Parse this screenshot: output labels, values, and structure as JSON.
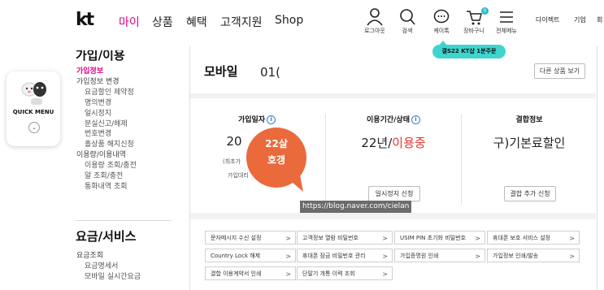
{
  "header": {
    "logo": "kt",
    "nav": [
      "마이",
      "상품",
      "혜택",
      "고객지원",
      "Shop"
    ],
    "icons": [
      {
        "name": "login-icon",
        "label": "로그아웃"
      },
      {
        "name": "search-icon",
        "label": "검색"
      },
      {
        "name": "chat-icon",
        "label": "케이톡"
      },
      {
        "name": "cart-icon",
        "label": "장바구니"
      },
      {
        "name": "menu-icon",
        "label": "전체메뉴"
      }
    ],
    "cart_count": "0",
    "right_links": [
      "다이렉트",
      "기업",
      "회"
    ],
    "promo_chip": "갤S22 KT샵 1분주문"
  },
  "quick_menu": {
    "label": "QUICK MENU",
    "arrow": "⌄"
  },
  "sidebar": {
    "section1_title": "가입/이용",
    "items": [
      {
        "label": "가입정보",
        "type": "active"
      },
      {
        "label": "가입정보 변경",
        "type": "main"
      },
      {
        "label": "요금할인 제약정",
        "type": "sub"
      },
      {
        "label": "명의변경",
        "type": "sub"
      },
      {
        "label": "일시정지",
        "type": "sub"
      },
      {
        "label": "분실신고/해제",
        "type": "sub"
      },
      {
        "label": "번호변경",
        "type": "sub"
      },
      {
        "label": "홀상품 해지신청",
        "type": "sub"
      },
      {
        "label": "이용량/이용내역",
        "type": "main"
      },
      {
        "label": "이용량 조회/충전",
        "type": "sub"
      },
      {
        "label": "알 조회/충전",
        "type": "sub"
      },
      {
        "label": "통화내역 조회",
        "type": "sub"
      }
    ],
    "section2_title": "요금/서비스",
    "items2": [
      {
        "label": "요금조회",
        "type": "main"
      },
      {
        "label": "요금명세서",
        "type": "sub"
      },
      {
        "label": "모바일 실시간요금",
        "type": "sub"
      }
    ]
  },
  "main": {
    "product_title": "모바일",
    "phone_number": "01(",
    "other_products_button": "다른 상품 보기",
    "columns": [
      {
        "title": "가입일자",
        "value": "20",
        "notes": [
          "(최초가",
          "가입대리"
        ]
      },
      {
        "title": "이용기간/상태",
        "value_period": "22년/",
        "value_status": "이용중",
        "button": "일시정지 신청"
      },
      {
        "title": "결합정보",
        "value": "구)기본료할인",
        "button": "결합 추가 신청"
      }
    ],
    "services": [
      "문자메시지 수신 설정",
      "고객정보 열람 비밀번호",
      "USIM PIN 초기화 비밀번호",
      "휴대폰 보호 서비스 설정",
      "Country Lock 해제",
      "휴대폰 잠금 비밀번호 관리",
      "가입증명원 인쇄",
      "가입정보 인쇄/발송",
      "결합 이용계약서 인쇄",
      "단말기 개통 이력 조회"
    ],
    "chevron": ">"
  },
  "overlay": {
    "bubble_line1": "22살",
    "bubble_line2": "호갱",
    "url": "https://blog.naver.com/cielan"
  },
  "colors": {
    "accent": "#e5008a",
    "chip": "#3fd5cf",
    "bubble": "#ea6a3c",
    "status_red": "#e8352c"
  }
}
